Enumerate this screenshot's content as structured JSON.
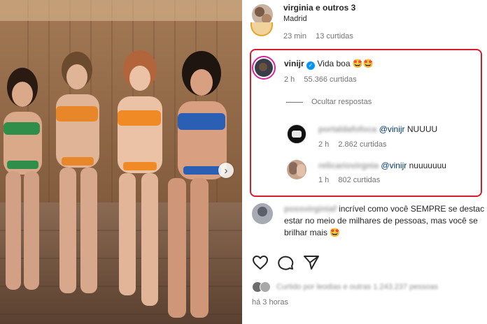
{
  "header": {
    "title": "virginia e outros 3",
    "location": "Madrid"
  },
  "prev_comment": {
    "time": "23 min",
    "likes": "13 curtidas"
  },
  "main_comment": {
    "username": "vinijr",
    "text": "Vida boa 🤩🤩",
    "time": "2 h",
    "likes": "55.366 curtidas"
  },
  "hide_replies": "Ocultar respostas",
  "replies": [
    {
      "username": "portaldafofoca",
      "mention": "@vinijr",
      "text": "NUUUU",
      "time": "2 h",
      "likes": "2.862 curtidas"
    },
    {
      "username": "relicariovirgnia",
      "mention": "@vinijr",
      "text": "nuuuuuuu",
      "time": "1 h",
      "likes": "802 curtidas"
    }
  ],
  "next_comment": {
    "username": "possvirginiaf",
    "lines": [
      "incrível como você SEMPRE se destac",
      "estar no meio de milhares de pessoas, mas você se",
      "brilhar mais 🤩"
    ]
  },
  "liked_by": "Curtido por leodias e outras 1.243.237 pessoas",
  "post_time": "há 3 horas",
  "colors": {
    "highlight": "#d91c2a",
    "mention": "#00376b",
    "verified": "#0095f6"
  }
}
